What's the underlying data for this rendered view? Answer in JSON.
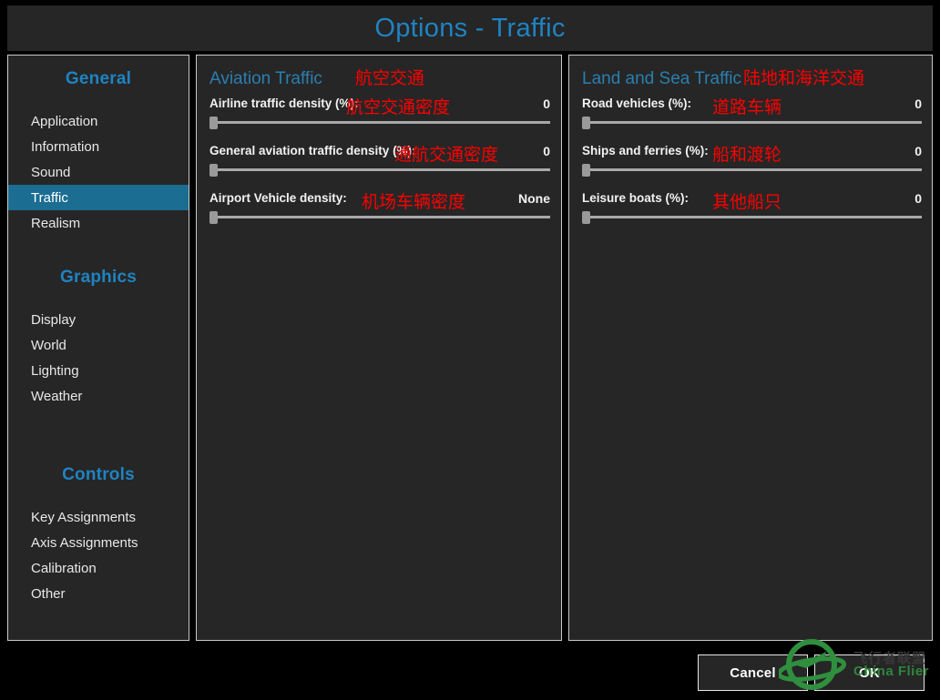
{
  "window": {
    "title": "Options - Traffic",
    "accent_color": "#1f83c2",
    "annotation_color": "#fc0000",
    "panel_bg": "#262626",
    "selected_bg": "#1b6d92"
  },
  "sidebar": {
    "groups": [
      {
        "title": "General",
        "items": [
          {
            "label": "Application",
            "selected": false
          },
          {
            "label": "Information",
            "selected": false
          },
          {
            "label": "Sound",
            "selected": false
          },
          {
            "label": "Traffic",
            "selected": true
          },
          {
            "label": "Realism",
            "selected": false
          }
        ]
      },
      {
        "title": "Graphics",
        "items": [
          {
            "label": "Display",
            "selected": false
          },
          {
            "label": "World",
            "selected": false
          },
          {
            "label": "Lighting",
            "selected": false
          },
          {
            "label": "Weather",
            "selected": false
          }
        ]
      },
      {
        "title": "Controls",
        "items": [
          {
            "label": "Key Assignments",
            "selected": false
          },
          {
            "label": "Axis Assignments",
            "selected": false
          },
          {
            "label": "Calibration",
            "selected": false
          },
          {
            "label": "Other",
            "selected": false
          }
        ]
      }
    ]
  },
  "aviation": {
    "section_title": "Aviation Traffic",
    "section_title_cn": "航空交通",
    "rows": [
      {
        "label": "Airline traffic density (%):",
        "cn_note": "航空交通密度",
        "value": "0",
        "slider_percent": 0
      },
      {
        "label": "General aviation traffic density (%):",
        "cn_note": "通航交通密度",
        "value": "0",
        "slider_percent": 0
      },
      {
        "label": "Airport Vehicle density:",
        "cn_note": "机场车辆密度",
        "value": "None",
        "slider_percent": 0
      }
    ]
  },
  "land": {
    "section_title": "Land and Sea Traffic",
    "section_title_cn": "陆地和海洋交通",
    "rows": [
      {
        "label": "Road vehicles (%):",
        "cn_note": "道路车辆",
        "value": "0",
        "slider_percent": 0
      },
      {
        "label": "Ships and ferries (%):",
        "cn_note": "船和渡轮",
        "value": "0",
        "slider_percent": 0
      },
      {
        "label": "Leisure boats (%):",
        "cn_note": "其他船只",
        "value": "0",
        "slider_percent": 0
      }
    ]
  },
  "footer": {
    "cancel_label": "Cancel",
    "ok_label": "OK"
  },
  "watermark": {
    "cn_text": "飞行者联盟",
    "en_text": "China Flier",
    "color": "#2f8f3e"
  }
}
